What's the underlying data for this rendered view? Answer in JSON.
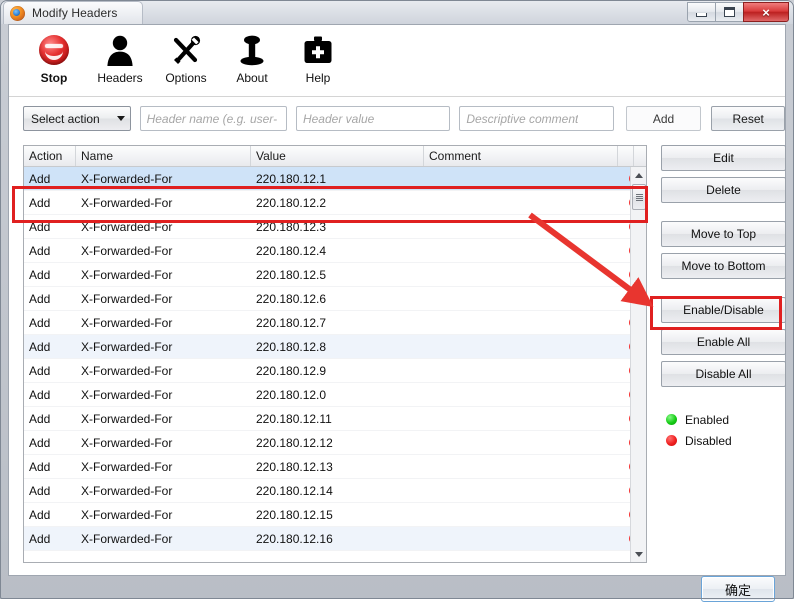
{
  "window": {
    "title": "Modify Headers",
    "app_icon": "firefox-icon",
    "minimize_label": "Minimize",
    "maximize_label": "Maximize",
    "close_label": "×"
  },
  "toolbar": {
    "items": [
      {
        "label": "Stop",
        "icon": "stop-icon"
      },
      {
        "label": "Headers",
        "icon": "person-icon"
      },
      {
        "label": "Options",
        "icon": "tools-icon"
      },
      {
        "label": "About",
        "icon": "info-icon"
      },
      {
        "label": "Help",
        "icon": "first-aid-kit-icon"
      }
    ]
  },
  "input_row": {
    "action_select": {
      "value": "Select action",
      "arrow_icon": "chevron-down-icon"
    },
    "header_name": {
      "value": "",
      "placeholder": "Header name (e.g. user-"
    },
    "header_value": {
      "value": "",
      "placeholder": "Header value"
    },
    "comment": {
      "value": "",
      "placeholder": "Descriptive comment"
    },
    "add_label": "Add",
    "reset_label": "Reset"
  },
  "table": {
    "columns": [
      "Action",
      "Name",
      "Value",
      "Comment"
    ],
    "rows": [
      {
        "action": "Add",
        "name": "X-Forwarded-For",
        "value": "220.180.12.1",
        "comment": "",
        "status": "Disabled",
        "selected": true
      },
      {
        "action": "Add",
        "name": "X-Forwarded-For",
        "value": "220.180.12.2",
        "comment": "",
        "status": "Disabled",
        "selected": false
      },
      {
        "action": "Add",
        "name": "X-Forwarded-For",
        "value": "220.180.12.3",
        "comment": "",
        "status": "Disabled",
        "selected": false
      },
      {
        "action": "Add",
        "name": "X-Forwarded-For",
        "value": "220.180.12.4",
        "comment": "",
        "status": "Disabled",
        "selected": false
      },
      {
        "action": "Add",
        "name": "X-Forwarded-For",
        "value": "220.180.12.5",
        "comment": "",
        "status": "Disabled",
        "selected": false
      },
      {
        "action": "Add",
        "name": "X-Forwarded-For",
        "value": "220.180.12.6",
        "comment": "",
        "status": "Disabled",
        "selected": false
      },
      {
        "action": "Add",
        "name": "X-Forwarded-For",
        "value": "220.180.12.7",
        "comment": "",
        "status": "Disabled",
        "selected": false
      },
      {
        "action": "Add",
        "name": "X-Forwarded-For",
        "value": "220.180.12.8",
        "comment": "",
        "status": "Disabled",
        "selected": false
      },
      {
        "action": "Add",
        "name": "X-Forwarded-For",
        "value": "220.180.12.9",
        "comment": "",
        "status": "Disabled",
        "selected": false
      },
      {
        "action": "Add",
        "name": "X-Forwarded-For",
        "value": "220.180.12.0",
        "comment": "",
        "status": "Disabled",
        "selected": false
      },
      {
        "action": "Add",
        "name": "X-Forwarded-For",
        "value": "220.180.12.11",
        "comment": "",
        "status": "Disabled",
        "selected": false
      },
      {
        "action": "Add",
        "name": "X-Forwarded-For",
        "value": "220.180.12.12",
        "comment": "",
        "status": "Disabled",
        "selected": false
      },
      {
        "action": "Add",
        "name": "X-Forwarded-For",
        "value": "220.180.12.13",
        "comment": "",
        "status": "Disabled",
        "selected": false
      },
      {
        "action": "Add",
        "name": "X-Forwarded-For",
        "value": "220.180.12.14",
        "comment": "",
        "status": "Disabled",
        "selected": false
      },
      {
        "action": "Add",
        "name": "X-Forwarded-For",
        "value": "220.180.12.15",
        "comment": "",
        "status": "Disabled",
        "selected": false
      },
      {
        "action": "Add",
        "name": "X-Forwarded-For",
        "value": "220.180.12.16",
        "comment": "",
        "status": "Disabled",
        "selected": false
      }
    ],
    "scrollbar": {
      "up_icon": "scroll-up-arrow-icon",
      "down_icon": "scroll-down-arrow-icon"
    }
  },
  "side_buttons": {
    "edit": "Edit",
    "delete": "Delete",
    "move_to_top": "Move to Top",
    "move_to_bottom": "Move to Bottom",
    "enable_disable": "Enable/Disable",
    "enable_all": "Enable All",
    "disable_all": "Disable All"
  },
  "legend": {
    "enabled_label": "Enabled",
    "disabled_label": "Disabled",
    "enabled_color": "#16cc16",
    "disabled_color": "#ef1f1f"
  },
  "footer": {
    "ok_label": "确定"
  },
  "annotations": {
    "highlight_color": "#e02020",
    "row_box_target": "first-table-rows",
    "button_box_target": "enable-disable-button",
    "arrow": "points-from-selected-row-to-enable-disable-button"
  }
}
